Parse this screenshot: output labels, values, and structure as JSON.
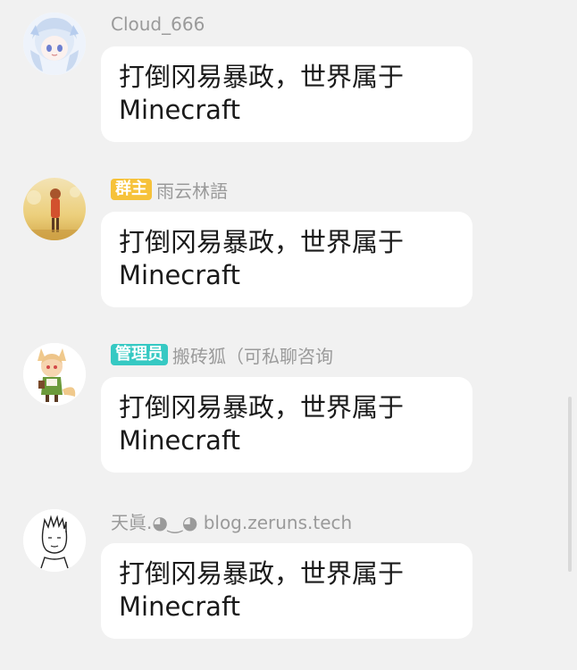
{
  "messages": [
    {
      "badge": "",
      "badge_type": "",
      "name": "Cloud_666",
      "text_line1": "打倒冈易暴政，世界属于",
      "text_line2": "Minecraft",
      "avatar_icon": "anime-girl-avatar-icon"
    },
    {
      "badge": "群主",
      "badge_type": "owner",
      "name": "雨云林語",
      "text_line1": "打倒冈易暴政，世界属于",
      "text_line2": "Minecraft",
      "avatar_icon": "field-girl-avatar-icon"
    },
    {
      "badge": "管理员",
      "badge_type": "admin",
      "name": "搬砖狐（可私聊咨询",
      "text_line1": "打倒冈易暴政，世界属于",
      "text_line2": "Minecraft",
      "avatar_icon": "fox-girl-avatar-icon"
    },
    {
      "badge": "",
      "badge_type": "",
      "name": "天眞.◕‿◕ blog.zeruns.tech",
      "text_line1": "打倒冈易暴政，世界属于",
      "text_line2": "Minecraft",
      "avatar_icon": "sketch-boy-avatar-icon"
    }
  ],
  "colors": {
    "background": "#f1f1f1",
    "bubble": "#ffffff",
    "owner_badge": "#f6c23a",
    "admin_badge": "#36c9c3",
    "name_text": "#9a9a9a"
  }
}
